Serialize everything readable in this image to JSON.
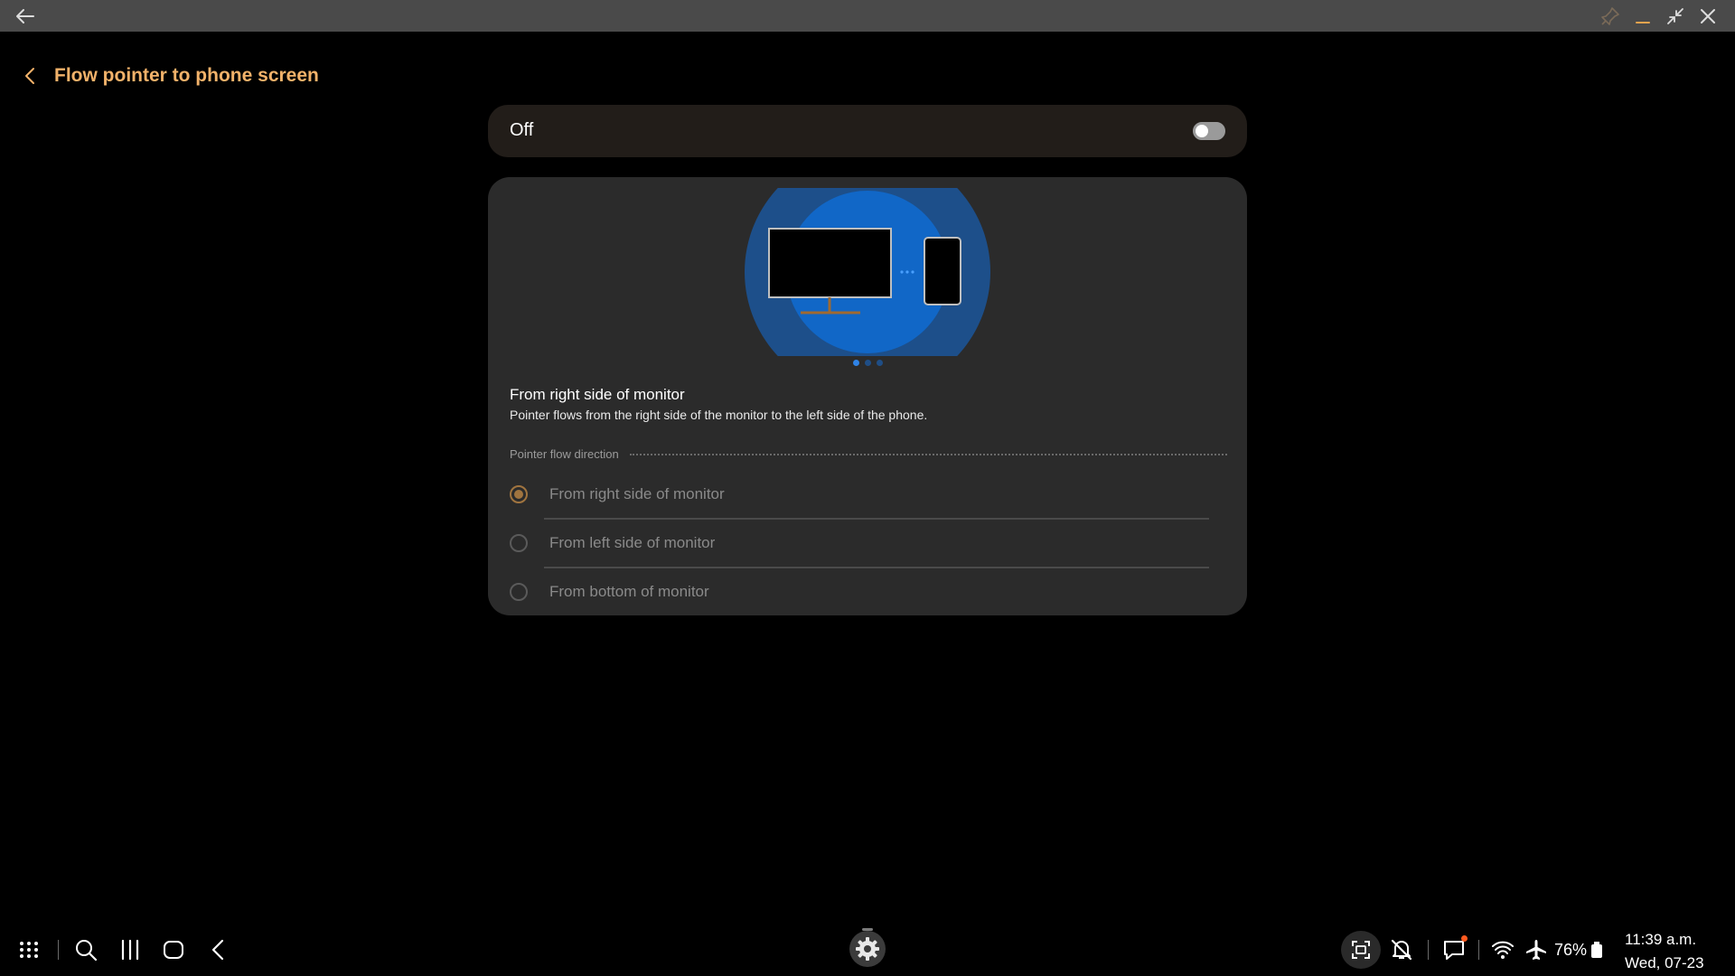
{
  "window": {
    "back_icon": "back-arrow-icon",
    "controls": [
      "pin-icon",
      "minimize-icon",
      "restore-icon",
      "close-icon"
    ]
  },
  "header": {
    "title": "Flow pointer to phone screen",
    "accent_color": "#f2b26a"
  },
  "master_toggle": {
    "label": "Off",
    "state": false
  },
  "illustration": {
    "description_icon": "monitor-to-phone-illustration",
    "page_count": 3,
    "active_page": 1
  },
  "description": {
    "title": "From right side of monitor",
    "text": "Pointer flows from the right side of the monitor to the left side of the phone."
  },
  "direction": {
    "section_label": "Pointer flow direction",
    "options": [
      {
        "label": "From right side of monitor",
        "selected": true
      },
      {
        "label": "From left side of monitor",
        "selected": false
      },
      {
        "label": "From bottom of monitor",
        "selected": false
      }
    ]
  },
  "taskbar": {
    "left_icons": [
      "apps-grid-icon",
      "search-icon",
      "recents-icon",
      "home-icon",
      "back-icon"
    ],
    "center_app": "settings-icon",
    "right_icons": [
      "screen-capture-icon",
      "mute-icon",
      "notification-icon",
      "wifi-icon",
      "airplane-icon",
      "battery-icon"
    ],
    "battery": "76%",
    "time": "11:39 a.m.",
    "date": "Wed, 07-23"
  }
}
